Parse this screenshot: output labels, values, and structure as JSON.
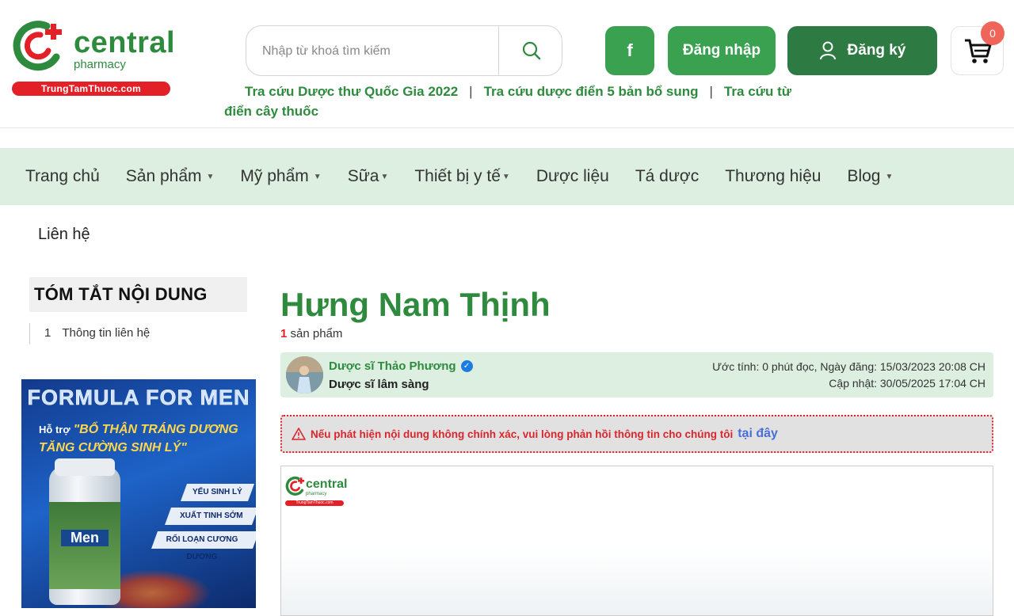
{
  "logo": {
    "brand": "central",
    "sub": "pharmacy",
    "bar": "TrungTamThuoc.com"
  },
  "search": {
    "placeholder": "Nhập từ khoá tìm kiếm"
  },
  "header_buttons": {
    "facebook": "f",
    "login": "Đăng nhập",
    "register": "Đăng ký",
    "cart_count": "0"
  },
  "quick_links": [
    "Tra cứu Dược thư Quốc Gia 2022",
    "Tra cứu dược điển 5 bản bổ sung",
    "Tra cứu từ điển cây thuốc"
  ],
  "quick_links_separator": "|",
  "nav": {
    "items": [
      {
        "label": "Trang chủ",
        "dropdown": false
      },
      {
        "label": "Sản phẩm",
        "dropdown": true
      },
      {
        "label": "Mỹ phẩm",
        "dropdown": true
      },
      {
        "label": "Sữa",
        "dropdown": true
      },
      {
        "label": "Thiết bị y tế",
        "dropdown": true
      },
      {
        "label": "Dược liệu",
        "dropdown": false
      },
      {
        "label": "Tá dược",
        "dropdown": false
      },
      {
        "label": "Thương hiệu",
        "dropdown": false
      },
      {
        "label": "Blog",
        "dropdown": true
      }
    ]
  },
  "breadcrumb": "Liên hệ",
  "toc": {
    "title": "TÓM TẮT NỘI DUNG",
    "items": [
      {
        "num": "1",
        "label": "Thông tin liên hệ"
      }
    ]
  },
  "banner": {
    "title": "FORMULA FOR MEN",
    "lead": "Hỗ trợ",
    "slogan": "\"BỔ THẬN TRÁNG DƯƠNG TĂNG CƯỜNG SINH LÝ\"",
    "tags": [
      "YẾU SINH LÝ",
      "XUẤT TINH SỚM",
      "RỐI LOẠN CƯƠNG DƯƠNG"
    ],
    "bottle_label": "Men"
  },
  "main": {
    "title": "Hưng Nam Thịnh",
    "count_number": "1",
    "count_label": "sản phẩm"
  },
  "author": {
    "name": "Dược sĩ Thảo Phương",
    "role": "Dược sĩ lâm sàng",
    "meta_line1": "Ước tính: 0 phút đọc, Ngày đăng: 15/03/2023 20:08 CH",
    "meta_line2": "Cập nhật: 30/05/2025 17:04 CH"
  },
  "alert": {
    "text": "Nếu phát hiện nội dung không chính xác, vui lòng phản hồi thông tin cho chúng tôi",
    "link": "tại đây"
  },
  "colors": {
    "brand_green": "#2e8b3e",
    "button_green": "#39a150",
    "dark_green": "#2d7a43",
    "nav_bg": "#dcefe0",
    "red": "#e31f27"
  }
}
